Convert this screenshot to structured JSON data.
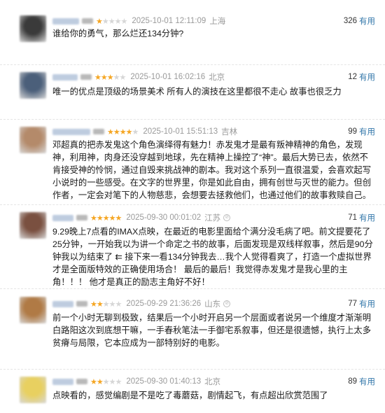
{
  "reviews": [
    {
      "rating": 1,
      "time": "2025-10-01 12:11:09",
      "location": "上海",
      "votes": "326",
      "useful_label": "有用",
      "content": "谁给你的勇气，那么烂还134分钟?",
      "avatar_color": "#3a3a3a"
    },
    {
      "rating": 3,
      "time": "2025-10-01 16:02:16",
      "location": "北京",
      "votes": "12",
      "useful_label": "有用",
      "content": "唯一的优点是顶级的场景美术 所有人的演技在这里都很不走心 故事也很乏力",
      "avatar_color": "#4b5f7a"
    },
    {
      "rating": 4,
      "time": "2025-10-01 15:51:13",
      "location": "吉林",
      "votes": "99",
      "useful_label": "有用",
      "content": "邓超真的把赤发鬼这个角色演绎得有魅力！赤发鬼才是最有叛神精神的角色，发现神，利用神，肉身还没穿越到地球，先在精神上操控了“神”。最后大势已去，依然不肯接受神的怜悯，通过自毁来挑战神的剧本。我对这个系列一直很温爱，会喜欢起写小说时的一些感受。在文字的世界里，你是如此自由，拥有创世与灭世的能力。但创作者，一定会对笔下的人物慈悲，会想要去拯救他们，也通过他们的故事救赎自己。",
      "avatar_color": "#b48a6a"
    },
    {
      "rating": 5,
      "time": "2025-09-30 00:01:02",
      "location": "江苏",
      "votes": "71",
      "useful_label": "有用",
      "content": "9.29晚上7点看的IMAX点映，在最近的电影里面给个满分没毛病了吧。前文提要花了25分钟，一开始我以为讲一个命定之书的故事，后面发现是双线样叙事，然后是90分钟我以为结束了 ⇇ 接下来一看134分钟我去…我个人觉得看爽了，打造一个虚拟世界才是全面版特效的正确使用场合！ 最后的最后！我觉得赤发鬼才是我心里的主角！！！ 他才是真正的励志主角好不好！",
      "avatar_color": "#7a5040"
    },
    {
      "rating": 2,
      "time": "2025-09-29 21:36:26",
      "location": "山东",
      "votes": "77",
      "useful_label": "有用",
      "content": "前一个小时无聊到极致，结果后一个小时开启另一个层面或者说另一个维度才渐渐明白路阳这次到底想干嘛，一手春秋笔法一手御宅系叙事，但还是很遗憾，执行上太多贫瘠与局限，它本应成为一部特别好的电影。",
      "avatar_color": "#b07a45"
    },
    {
      "rating": 2,
      "time": "2025-09-30 01:40:13",
      "location": "北京",
      "votes": "89",
      "useful_label": "有用",
      "content": "点映看的，感觉编剧是不是吃了毒蘑菇，剧情起飞，有点超出欣赏范围了",
      "avatar_color": "#e8d060"
    }
  ]
}
